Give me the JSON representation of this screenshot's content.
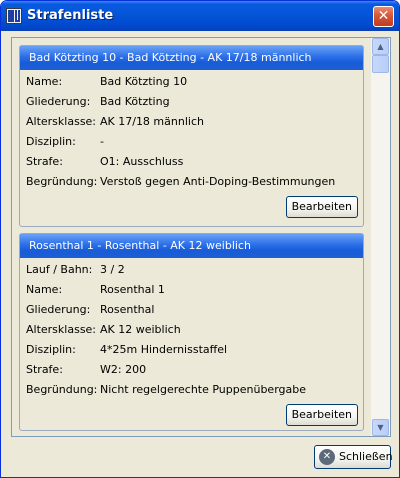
{
  "window": {
    "title": "Strafenliste",
    "close_glyph": "✕"
  },
  "entries": [
    {
      "header": "Bad Kötzting 10 - Bad Kötzting - AK 17/18 männlich",
      "fields": [
        {
          "label": "Name:",
          "value": "Bad Kötzting 10"
        },
        {
          "label": "Gliederung:",
          "value": "Bad Kötzting"
        },
        {
          "label": "Altersklasse:",
          "value": "AK 17/18 männlich"
        },
        {
          "label": "Disziplin:",
          "value": "-"
        },
        {
          "label": "Strafe:",
          "value": "O1: Ausschluss"
        },
        {
          "label": "Begründung:",
          "value": "Verstoß gegen Anti-Doping-Bestimmungen"
        }
      ],
      "edit_label": "Bearbeiten"
    },
    {
      "header": "Rosenthal 1 - Rosenthal - AK 12 weiblich",
      "fields": [
        {
          "label": "Lauf / Bahn:",
          "value": "3 / 2"
        },
        {
          "label": "Name:",
          "value": "Rosenthal 1"
        },
        {
          "label": "Gliederung:",
          "value": "Rosenthal"
        },
        {
          "label": "Altersklasse:",
          "value": "AK 12 weiblich"
        },
        {
          "label": "Disziplin:",
          "value": "4*25m Hindernisstaffel"
        },
        {
          "label": "Strafe:",
          "value": "W2: 200"
        },
        {
          "label": "Begründung:",
          "value": "Nicht regelgerechte Puppenübergabe"
        }
      ],
      "edit_label": "Bearbeiten"
    }
  ],
  "scrollbar": {
    "up_glyph": "▲",
    "down_glyph": "▼"
  },
  "footer": {
    "close_label": "Schließen",
    "close_icon_glyph": "✕"
  },
  "colors": {
    "title_bar": "#0454d8",
    "card_header": "#2a6ee8",
    "window_bg": "#ece9d8",
    "close_button": "#d7583a"
  },
  "icons": {
    "app": "app-logo-icon",
    "close": "close-icon",
    "scroll_up": "arrow-up-icon",
    "scroll_down": "arrow-down-icon",
    "footer_close": "close-circle-icon"
  }
}
